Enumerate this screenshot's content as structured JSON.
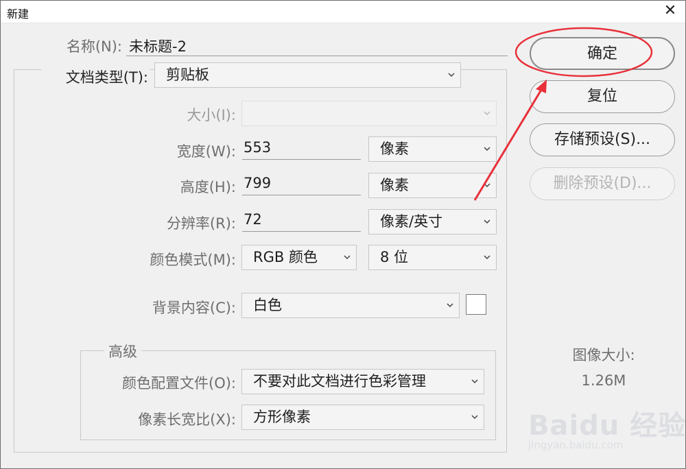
{
  "window": {
    "title": "新建",
    "close_glyph": "✕"
  },
  "form": {
    "name_label": "名称(N):",
    "name_value": "未标题-2",
    "doc_type_label": "文档类型(T):",
    "doc_type_value": "剪贴板",
    "size_label": "大小(I):",
    "size_value": "",
    "width_label": "宽度(W):",
    "width_value": "553",
    "width_unit": "像素",
    "height_label": "高度(H):",
    "height_value": "799",
    "height_unit": "像素",
    "resolution_label": "分辨率(R):",
    "resolution_value": "72",
    "resolution_unit": "像素/英寸",
    "color_mode_label": "颜色模式(M):",
    "color_mode_value": "RGB 颜色",
    "bit_depth_value": "8 位",
    "background_label": "背景内容(C):",
    "background_value": "白色"
  },
  "advanced": {
    "title": "高级",
    "color_profile_label": "颜色配置文件(O):",
    "color_profile_value": "不要对此文档进行色彩管理",
    "pixel_aspect_label": "像素长宽比(X):",
    "pixel_aspect_value": "方形像素"
  },
  "buttons": {
    "ok": "确定",
    "reset": "复位",
    "save_preset": "存储预设(S)...",
    "delete_preset": "删除预设(D)..."
  },
  "info": {
    "image_size_label": "图像大小:",
    "image_size_value": "1.26M"
  },
  "watermark": {
    "brand": "Baidu 经验",
    "url": "jingyan.baidu.com"
  },
  "colors": {
    "annotation_red": "#e8303a",
    "dialog_bg": "#f0f0f0"
  },
  "icons": {
    "dropdown": "chevron-down-icon",
    "close": "close-icon"
  }
}
